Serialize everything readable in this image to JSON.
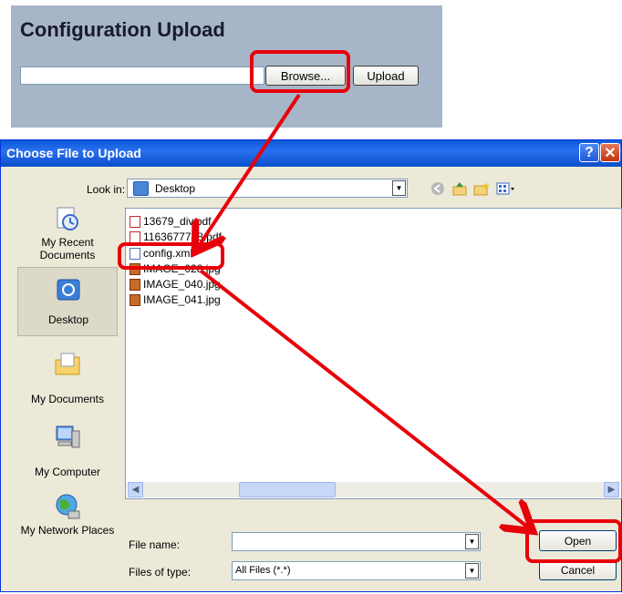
{
  "config_panel": {
    "title": "Configuration Upload",
    "path_value": "",
    "browse_label": "Browse...",
    "upload_label": "Upload"
  },
  "dialog": {
    "title": "Choose File to Upload",
    "help_label": "?",
    "close_label": "✕",
    "look_in_label": "Look in:",
    "look_in_value": "Desktop",
    "places": [
      {
        "label": "My Recent Documents",
        "icon": "recent-documents-icon"
      },
      {
        "label": "Desktop",
        "icon": "desktop-icon"
      },
      {
        "label": "My Documents",
        "icon": "my-documents-icon"
      },
      {
        "label": "My Computer",
        "icon": "my-computer-icon"
      },
      {
        "label": "My Network Places",
        "icon": "network-places-icon"
      }
    ],
    "files": [
      {
        "name": "13679_div.pdf",
        "type": "pdf"
      },
      {
        "name": "1163677748.pdf",
        "type": "pdf"
      },
      {
        "name": "config.xml",
        "type": "xml"
      },
      {
        "name": "IMAGE_028.jpg",
        "type": "jpg"
      },
      {
        "name": "IMAGE_040.jpg",
        "type": "jpg"
      },
      {
        "name": "IMAGE_041.jpg",
        "type": "jpg"
      }
    ],
    "file_name_label": "File name:",
    "file_name_value": "",
    "files_of_type_label": "Files of type:",
    "files_of_type_value": "All Files (*.*)",
    "open_label": "Open",
    "cancel_label": "Cancel"
  },
  "colors": {
    "annotation": "#e8000a",
    "titlebar": "#0a5ad8",
    "panel": "#a6b6c8"
  }
}
